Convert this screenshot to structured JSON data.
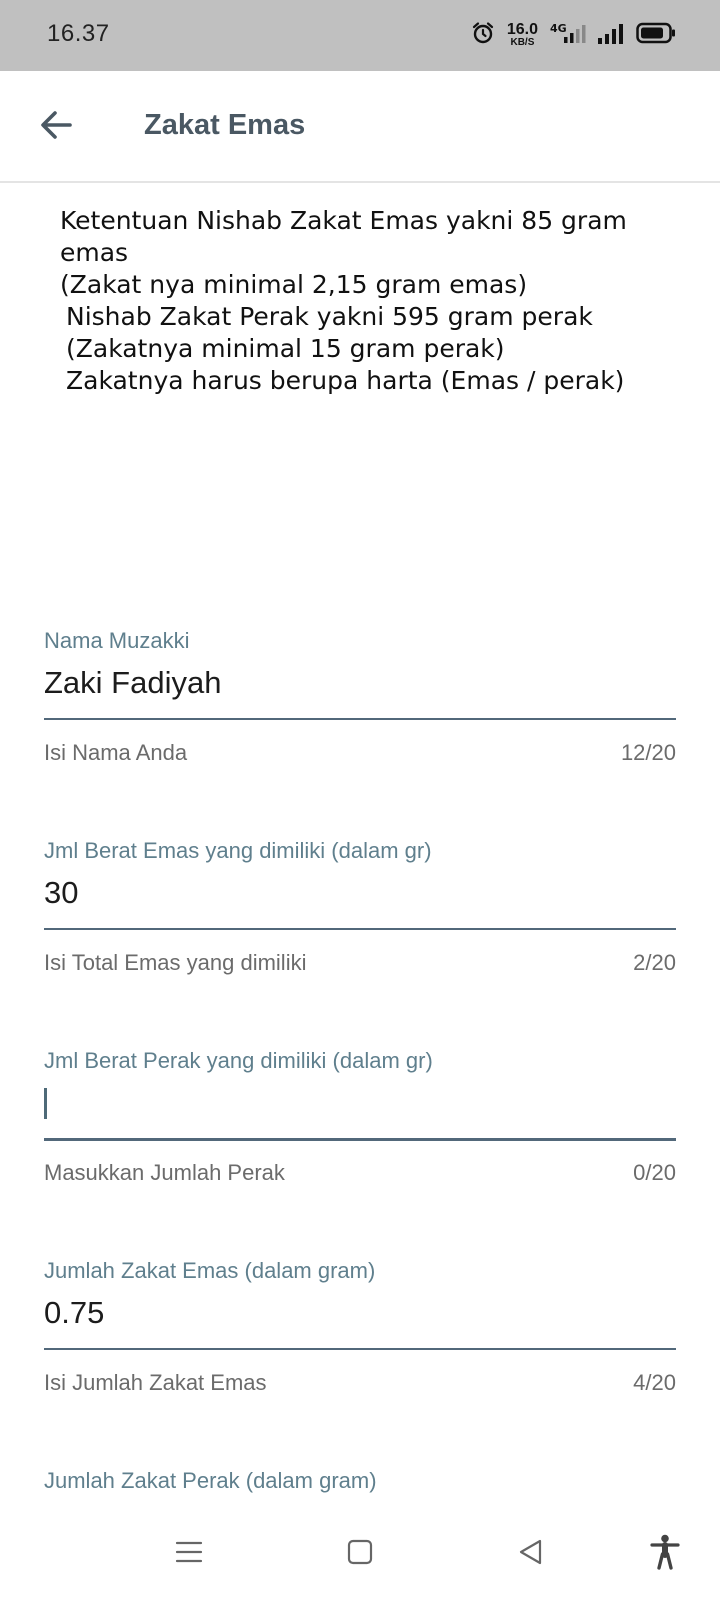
{
  "status_bar": {
    "time": "16.37",
    "net_speed": "16.0",
    "net_unit": "KB/S",
    "network_type": "4G",
    "icons": [
      "alarm-icon",
      "network-4g-icon",
      "signal-icon",
      "battery-icon"
    ]
  },
  "app_bar": {
    "title": "Zakat Emas",
    "back_icon": "arrow-left-icon"
  },
  "info": {
    "lines": [
      "Ketentuan Nishab Zakat Emas yakni 85 gram",
      "emas",
      "(Zakat nya minimal 2,15 gram emas)",
      "Nishab Zakat Perak yakni 595 gram perak",
      "(Zakatnya minimal 15 gram perak)",
      "Zakatnya harus berupa harta (Emas / perak)"
    ]
  },
  "form": {
    "fields": [
      {
        "label": "Nama Muzakki",
        "value": "Zaki Fadiyah",
        "helper": "Isi Nama Anda",
        "counter": "12/20"
      },
      {
        "label": "Jml Berat Emas yang dimiliki (dalam gr)",
        "value": "30",
        "helper": "Isi Total Emas yang dimiliki",
        "counter": "2/20"
      },
      {
        "label": "Jml Berat Perak yang dimiliki (dalam gr)",
        "value": "",
        "helper": "Masukkan Jumlah Perak",
        "counter": "0/20"
      },
      {
        "label": "Jumlah Zakat Emas (dalam gram)",
        "value": "0.75",
        "helper": "Isi Jumlah Zakat Emas",
        "counter": "4/20"
      },
      {
        "label": "Jumlah Zakat Perak (dalam gram)"
      }
    ]
  },
  "nav_bar": {
    "icons": [
      "menu-icon",
      "home-square-icon",
      "back-triangle-icon",
      "accessibility-icon"
    ]
  },
  "colors": {
    "status_bar_bg": "#c0c0c0",
    "label": "#5f7f8d",
    "underline": "#52687a",
    "title": "#4a5863"
  }
}
